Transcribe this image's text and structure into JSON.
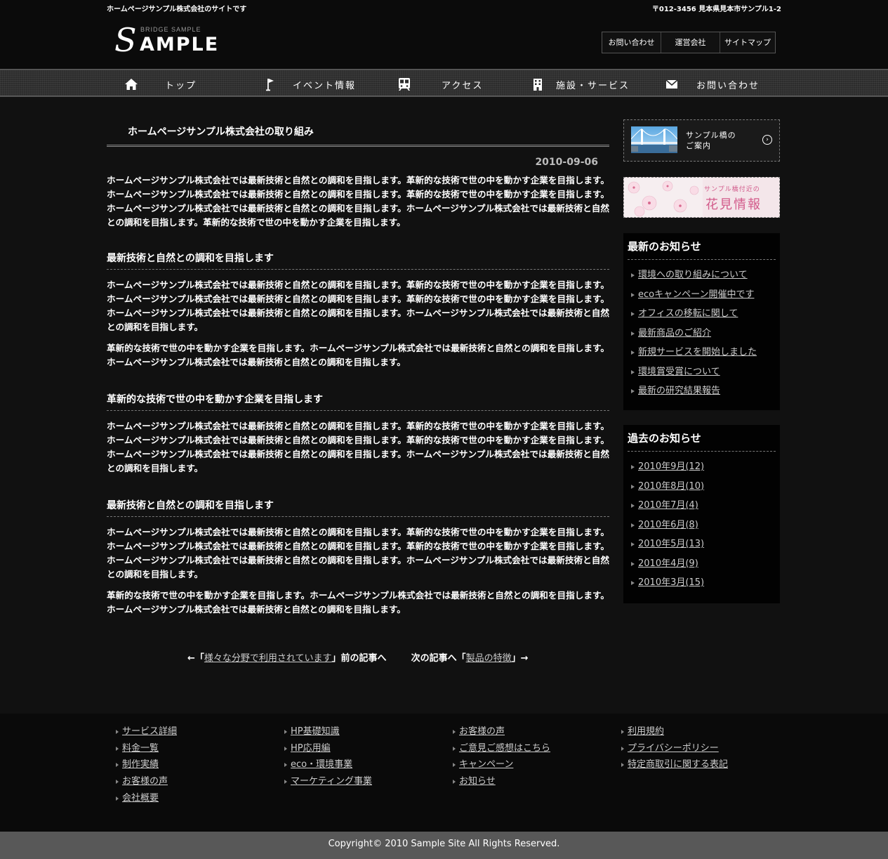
{
  "header": {
    "tagline": "ホームページサンプル株式会社のサイトです",
    "address": "〒012-3456 見本県見本市サンプル1-2",
    "logo_sub": "BRIDGE SAMPLE",
    "logo_s": "S",
    "logo_rest": "AMPLE",
    "utility_nav": [
      "お問い合わせ",
      "運営会社",
      "サイトマップ"
    ]
  },
  "global_nav": [
    {
      "label": "トップ",
      "icon": "home-icon"
    },
    {
      "label": "イベント情報",
      "icon": "flag-icon"
    },
    {
      "label": "アクセス",
      "icon": "train-icon"
    },
    {
      "label": "施設・サービス",
      "icon": "building-icon"
    },
    {
      "label": "お問い合わせ",
      "icon": "mail-icon"
    }
  ],
  "main": {
    "page_title": "ホームページサンプル株式会社の取り組み",
    "date": "2010-09-06",
    "intro": "ホームページサンプル株式会社では最新技術と自然との調和を目指します。革新的な技術で世の中を動かす企業を目指します。ホームページサンプル株式会社では最新技術と自然との調和を目指します。革新的な技術で世の中を動かす企業を目指します。ホームページサンプル株式会社では最新技術と自然との調和を目指します。ホームページサンプル株式会社では最新技術と自然との調和を目指します。革新的な技術で世の中を動かす企業を目指します。",
    "sections": [
      {
        "heading": "最新技術と自然との調和を目指します",
        "paragraphs": [
          "ホームページサンプル株式会社では最新技術と自然との調和を目指します。革新的な技術で世の中を動かす企業を目指します。ホームページサンプル株式会社では最新技術と自然との調和を目指します。革新的な技術で世の中を動かす企業を目指します。ホームページサンプル株式会社では最新技術と自然との調和を目指します。ホームページサンプル株式会社では最新技術と自然との調和を目指します。",
          "革新的な技術で世の中を動かす企業を目指します。ホームページサンプル株式会社では最新技術と自然との調和を目指します。ホームページサンプル株式会社では最新技術と自然との調和を目指します。"
        ]
      },
      {
        "heading": "革新的な技術で世の中を動かす企業を目指します",
        "paragraphs": [
          "ホームページサンプル株式会社では最新技術と自然との調和を目指します。革新的な技術で世の中を動かす企業を目指します。ホームページサンプル株式会社では最新技術と自然との調和を目指します。革新的な技術で世の中を動かす企業を目指します。ホームページサンプル株式会社では最新技術と自然との調和を目指します。ホームページサンプル株式会社では最新技術と自然との調和を目指します。"
        ]
      },
      {
        "heading": "最新技術と自然との調和を目指します",
        "paragraphs": [
          "ホームページサンプル株式会社では最新技術と自然との調和を目指します。革新的な技術で世の中を動かす企業を目指します。ホームページサンプル株式会社では最新技術と自然との調和を目指します。革新的な技術で世の中を動かす企業を目指します。ホームページサンプル株式会社では最新技術と自然との調和を目指します。ホームページサンプル株式会社では最新技術と自然との調和を目指します。",
          "革新的な技術で世の中を動かす企業を目指します。ホームページサンプル株式会社では最新技術と自然との調和を目指します。ホームページサンプル株式会社では最新技術と自然との調和を目指します。"
        ]
      }
    ],
    "article_nav": {
      "prev_prefix": "←「",
      "prev_link": "様々な分野で利用されています",
      "prev_suffix": "」前の記事へ",
      "next_prefix": "次の記事へ「",
      "next_link": "製品の特徴",
      "next_suffix": "」→"
    }
  },
  "sidebar": {
    "bridge_banner": {
      "line1": "サンプル橋の",
      "line2": "ご案内"
    },
    "hanami_banner": {
      "line1": "サンプル橋付近の",
      "line2": "花見情報"
    },
    "latest_news": {
      "title": "最新のお知らせ",
      "items": [
        "環境への取り組みについて",
        "ecoキャンペーン開催中です",
        "オフィスの移転に関して",
        "最新商品のご紹介",
        "新規サービスを開始しました",
        "環境賞受賞について",
        "最新の研究結果報告"
      ]
    },
    "past_news": {
      "title": "過去のお知らせ",
      "items": [
        "2010年9月(12)",
        "2010年8月(10)",
        "2010年7月(4)",
        "2010年6月(8)",
        "2010年5月(13)",
        "2010年4月(9)",
        "2010年3月(15)"
      ]
    }
  },
  "footer": {
    "columns": [
      [
        "サービス詳細",
        "料金一覧",
        "制作実績",
        "お客様の声",
        "会社概要"
      ],
      [
        "HP基礎知識",
        "HP応用編",
        "eco・環境事業",
        "マーケティング事業"
      ],
      [
        "お客様の声",
        "ご意見ご感想はこちら",
        "キャンペーン",
        "お知らせ"
      ],
      [
        "利用規約",
        "プライバシーポリシー",
        "特定商取引に関する表記"
      ]
    ],
    "copyright": "Copyright© 2010 Sample Site All Rights Reserved."
  }
}
